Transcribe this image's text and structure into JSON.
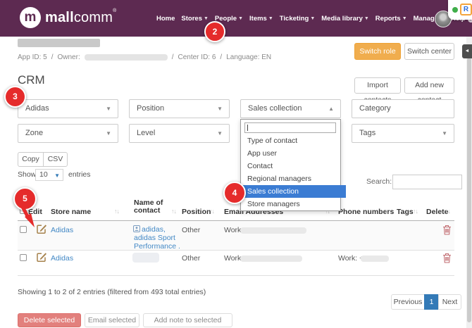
{
  "nav": {
    "brand_initial": "m",
    "brand_bold": "mall",
    "brand_light": "comm",
    "reg_mark": "®",
    "items": [
      {
        "label": "Home"
      },
      {
        "label": "Stores"
      },
      {
        "label": "People"
      },
      {
        "label": "Items"
      },
      {
        "label": "Ticketing"
      },
      {
        "label": "Media library"
      },
      {
        "label": "Reports"
      },
      {
        "label": "Manage"
      },
      {
        "label": "Help"
      }
    ]
  },
  "context": {
    "app_id": "App ID: 5",
    "sep": "/",
    "owner_label": "Owner:",
    "center_id": "Center ID: 6",
    "language": "Language: EN",
    "switch_role": "Switch role",
    "switch_center": "Switch center"
  },
  "page": {
    "title": "CRM",
    "import_contacts": "Import contacts",
    "add_new_contact": "Add new contact"
  },
  "filters": {
    "store": "Adidas",
    "position": "Position",
    "type_of_contact": "Sales collection",
    "category": "Category",
    "zone": "Zone",
    "level": "Level",
    "tags": "Tags"
  },
  "dropdown": {
    "search_value": "",
    "options": [
      "Type of contact",
      "App user",
      "Contact",
      "Regional managers",
      "Sales collection",
      "Store managers"
    ],
    "selected": "Sales collection"
  },
  "table_controls": {
    "copy": "Copy",
    "csv": "CSV",
    "show_label": "Show",
    "page_length": "10",
    "entries_label": "entries",
    "search_label": "Search:",
    "search_value": ""
  },
  "table": {
    "headers": {
      "edit": "Edit",
      "store_name": "Store name",
      "name_of_contact": "Name of contact",
      "position": "Position",
      "email": "Email Addresses",
      "phone": "Phone numbers",
      "tags": "Tags",
      "delete": "Delete"
    },
    "rows": [
      {
        "store": "Adidas",
        "contact_lines": {
          "0": "adidas,",
          "1": "adidas Sport",
          "2": "Performance ."
        },
        "position": "Other",
        "email_label": "Work:",
        "phone_label": ""
      },
      {
        "store": "Adidas",
        "position": "Other",
        "email_label": "Work:",
        "phone_label": "Work: +"
      }
    ]
  },
  "footer": {
    "showing": "Showing 1 to 2 of 2 entries (filtered from 493 total entries)",
    "previous": "Previous",
    "current_page": "1",
    "next": "Next",
    "delete_selected": "Delete selected",
    "email_selected": "Email selected",
    "add_note": "Add note to selected contacts"
  },
  "badges": {
    "step2": "2",
    "step3": "3",
    "step4": "4",
    "step5": "5"
  },
  "colors": {
    "nav_purple": "#5d2a51",
    "accent_orange": "#f0ad4e",
    "link_blue": "#4288c5",
    "selection_blue": "#3b7cd3",
    "badge_red": "#e52b2b",
    "pagination_active": "#337ab7"
  }
}
